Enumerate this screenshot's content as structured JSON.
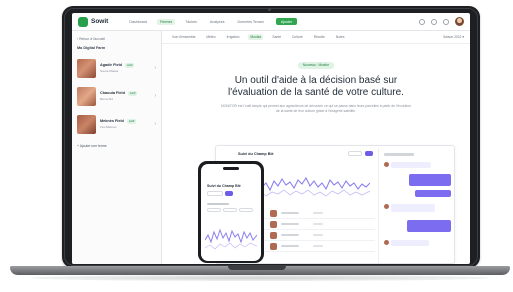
{
  "app": {
    "name": "Sowit",
    "brand_color": "#27a04a",
    "accent_color": "#6d5ce7"
  },
  "topbar": {
    "nav": [
      "Dashboard",
      "Fermes",
      "Tâches",
      "Analyses",
      "Données Terrain"
    ],
    "active_nav": "Fermes",
    "new_label": "Ajouter",
    "icons": [
      "search-icon",
      "bell-icon",
      "help-icon"
    ]
  },
  "sidebar": {
    "back_label": "‹ Retour à l'accueil",
    "title": "Ma Digital Farm",
    "farms": [
      {
        "name": "Agadir Field",
        "badge": "Actif",
        "sub": "Souss-Massa"
      },
      {
        "name": "Chaouia Field",
        "badge": "Actif",
        "sub": "Berrechid"
      },
      {
        "name": "Meknès Field",
        "badge": "Actif",
        "sub": "Fès-Meknès"
      }
    ],
    "add_label": "+ Ajouter une ferme"
  },
  "main": {
    "tabs": [
      "Vue d'ensemble",
      "Météo",
      "Irrigation",
      "Monitor",
      "Santé",
      "Culture",
      "Récolte",
      "Notes"
    ],
    "active_tab": "Monitor",
    "season": "Saison 2022 ▾",
    "hero": {
      "badge": "Nouveau · Monitor",
      "title_line1": "Un outil d'aide à la décision basé sur",
      "title_line2": "l'évaluation de la santé de votre culture.",
      "description": "MONITOR est l'outil simple qui permet aux agriculteurs de découvrir ce qui se passe dans leurs parcelles à partir de l'évolution de la santé de leur culture grâce à l'imagerie satellite."
    },
    "dashboard": {
      "title": "Suivi du Champ Blé"
    }
  },
  "phone": {
    "title": "Suivi du Champ Blé"
  }
}
